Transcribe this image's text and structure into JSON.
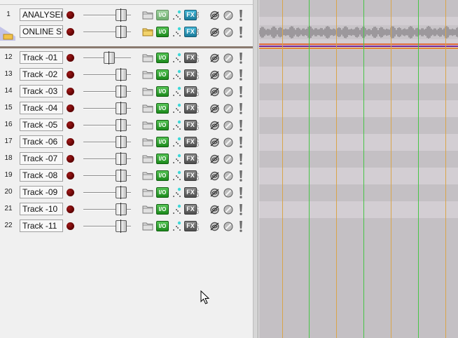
{
  "tracks": [
    {
      "num": "1",
      "name": "ANALYSER",
      "kind": "top",
      "io_dim": true,
      "fx_active": true,
      "switch": "ON"
    },
    {
      "num": "",
      "name": "ONLINE ST",
      "kind": "folder",
      "io_dim": false,
      "fx_active": true,
      "switch": "ON"
    },
    {
      "num": "12",
      "name": "Track -01",
      "kind": "track",
      "io_dim": false,
      "fx_active": false,
      "switch": "OFF"
    },
    {
      "num": "13",
      "name": "Track -02",
      "kind": "track",
      "io_dim": false,
      "fx_active": false,
      "switch": "OFF"
    },
    {
      "num": "14",
      "name": "Track -03",
      "kind": "track",
      "io_dim": false,
      "fx_active": false,
      "switch": "OFF"
    },
    {
      "num": "15",
      "name": "Track -04",
      "kind": "track",
      "io_dim": false,
      "fx_active": false,
      "switch": "OFF"
    },
    {
      "num": "16",
      "name": "Track -05",
      "kind": "track",
      "io_dim": false,
      "fx_active": false,
      "switch": "OFF"
    },
    {
      "num": "17",
      "name": "Track -06",
      "kind": "track",
      "io_dim": false,
      "fx_active": false,
      "switch": "OFF"
    },
    {
      "num": "18",
      "name": "Track -07",
      "kind": "track",
      "io_dim": false,
      "fx_active": false,
      "switch": "OFF"
    },
    {
      "num": "19",
      "name": "Track -08",
      "kind": "track",
      "io_dim": false,
      "fx_active": false,
      "switch": "OFF"
    },
    {
      "num": "20",
      "name": "Track -09",
      "kind": "track",
      "io_dim": false,
      "fx_active": false,
      "switch": "OFF"
    },
    {
      "num": "21",
      "name": "Track -10",
      "kind": "track",
      "io_dim": false,
      "fx_active": false,
      "switch": "OFF"
    },
    {
      "num": "22",
      "name": "Track -11",
      "kind": "track",
      "io_dim": false,
      "fx_active": false,
      "switch": "OFF"
    }
  ],
  "buttons": {
    "io_label": "I/O",
    "fx_label": "FX"
  },
  "icons": {
    "record_arm": "record-arm-icon",
    "folder": "folder-icon",
    "routing": "io-routing-icon",
    "envelope": "envelope-dots-icon",
    "fx": "fx-icon",
    "monitor": "monitor-off-icon",
    "phase": "phase-icon",
    "warning": "exclamation-icon"
  },
  "colors": {
    "rec_arm": "#6a0000",
    "io_green": "#28a028",
    "fx_active": "#2a98ba",
    "folder_yellow": "#f2d36a",
    "grid_green": "#47c447",
    "grid_orange": "#d9a54a",
    "separator": "#8a7a6f",
    "lane_light": "#d3ced3",
    "lane_dark": "#c4c0c4"
  }
}
